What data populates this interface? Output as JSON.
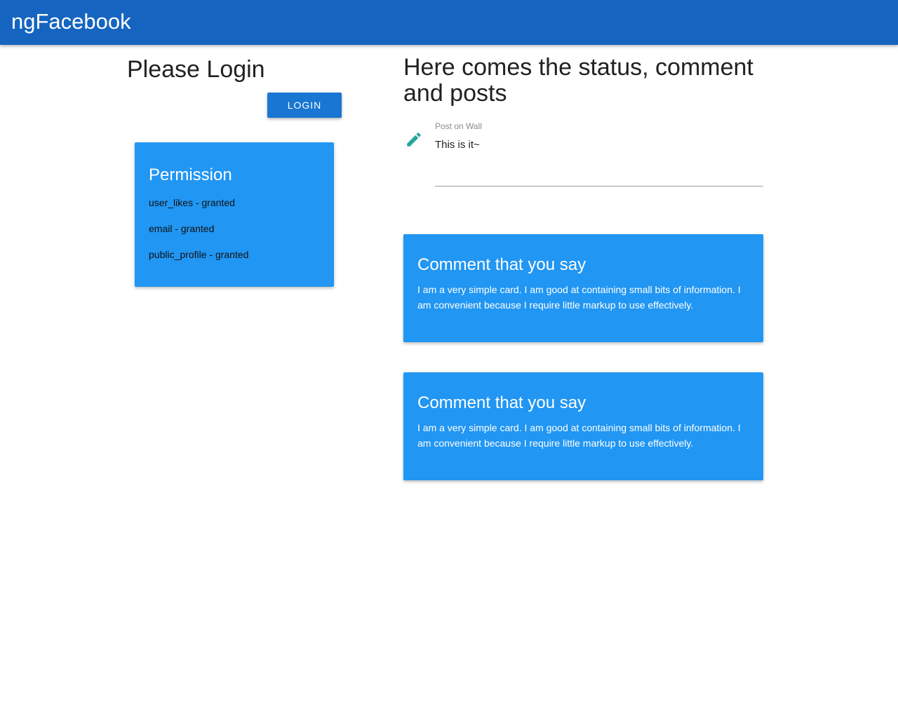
{
  "appbar": {
    "title": "ngFacebook",
    "color": "#1565c0"
  },
  "login": {
    "heading": "Please Login",
    "button_label": "LOGIN"
  },
  "permission_card": {
    "title": "Permission",
    "items": [
      "user_likes - granted",
      "email - granted",
      "public_profile - granted"
    ],
    "color": "#2196f3"
  },
  "main": {
    "heading": "Here comes the status, comment and posts",
    "post_field": {
      "icon": "pencil-icon",
      "label": "Post on Wall",
      "value": "This is it~"
    },
    "comments": [
      {
        "title": "Comment that you say",
        "body": "I am a very simple card. I am good at containing small bits of information. I am convenient because I require little markup to use effectively."
      },
      {
        "title": "Comment that you say",
        "body": "I am a very simple card. I am good at containing small bits of information. I am convenient because I require little markup to use effectively."
      }
    ]
  }
}
